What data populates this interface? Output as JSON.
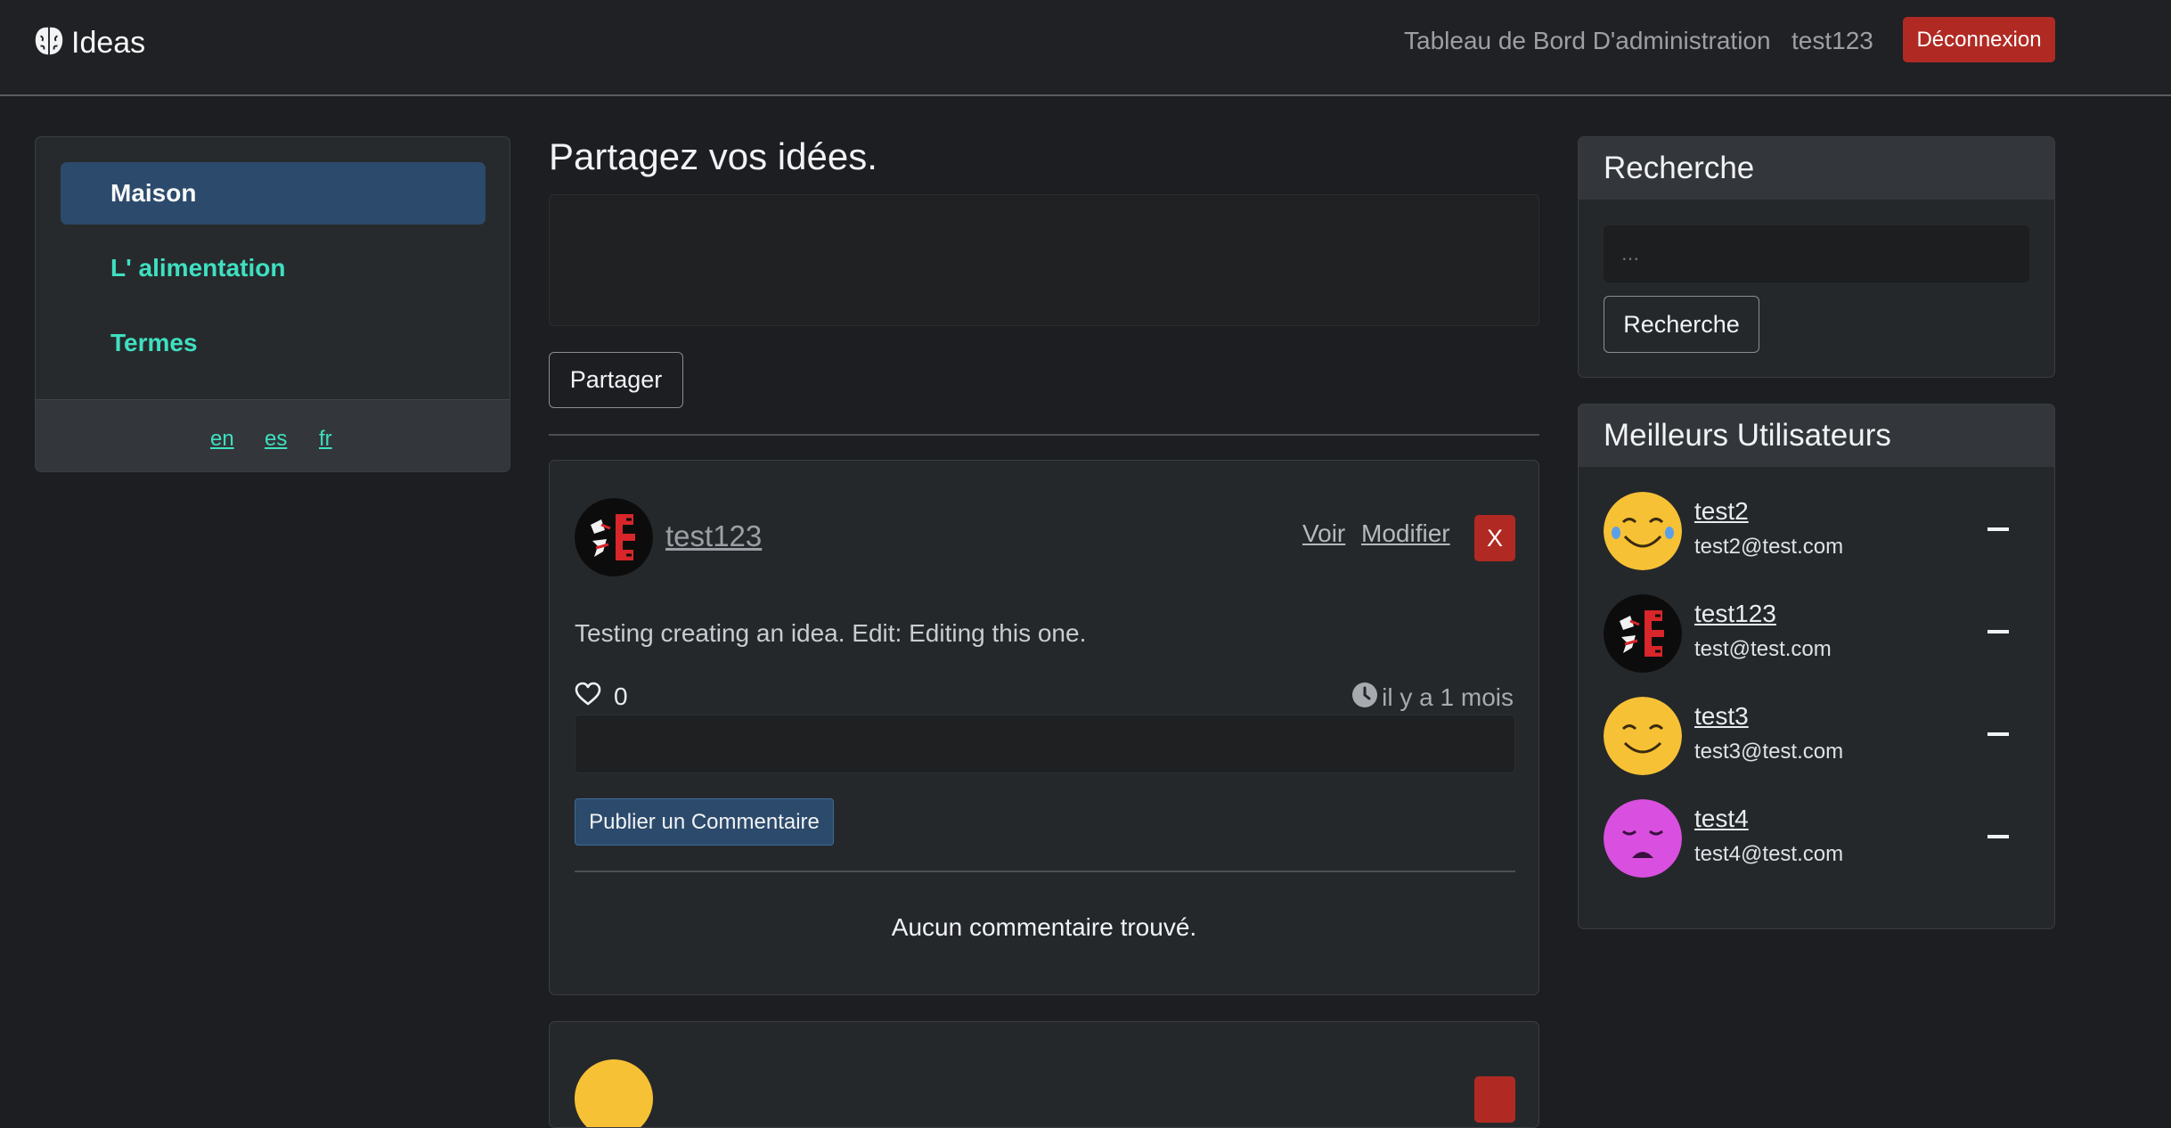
{
  "navbar": {
    "brand": "Ideas",
    "admin_link": "Tableau de Bord D'administration",
    "username": "test123",
    "logout": "Déconnexion"
  },
  "sidebar": {
    "items": [
      {
        "label": "Maison",
        "active": true
      },
      {
        "label": "L' alimentation",
        "active": false
      },
      {
        "label": "Termes",
        "active": false
      }
    ],
    "languages": [
      "en",
      "es",
      "fr"
    ]
  },
  "share": {
    "title": "Partagez vos idées.",
    "textarea_value": "",
    "button": "Partager"
  },
  "ideas": [
    {
      "author": "test123",
      "view_label": "Voir",
      "edit_label": "Modifier",
      "delete_label": "X",
      "content": "Testing creating an idea. Edit: Editing this one.",
      "likes": "0",
      "time": "il y a 1 mois",
      "comment_button": "Publier un Commentaire",
      "no_comments": "Aucun commentaire trouvé."
    }
  ],
  "search": {
    "title": "Recherche",
    "placeholder": "...",
    "button": "Recherche"
  },
  "top_users": {
    "title": "Meilleurs Utilisateurs",
    "users": [
      {
        "name": "test2",
        "email": "test2@test.com",
        "avatar": "laughing-emoji"
      },
      {
        "name": "test123",
        "email": "test@test.com",
        "avatar": "red-calligraphy-logo"
      },
      {
        "name": "test3",
        "email": "test3@test.com",
        "avatar": "smiling-emoji"
      },
      {
        "name": "test4",
        "email": "test4@test.com",
        "avatar": "sad-purple-emoji"
      }
    ]
  },
  "colors": {
    "accent": "#3ee0c0",
    "primary": "#2c4a6b",
    "danger": "#b02a23",
    "background": "#1c1e21"
  }
}
